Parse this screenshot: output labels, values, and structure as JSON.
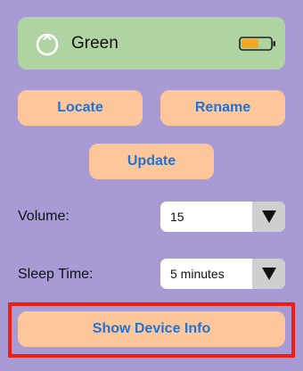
{
  "device": {
    "name": "Green",
    "icon": "power-ring-icon",
    "battery_icon": "battery-icon",
    "battery_level": 0.6,
    "battery_color": "#f5a623"
  },
  "actions": {
    "locate_label": "Locate",
    "rename_label": "Rename",
    "update_label": "Update",
    "show_info_label": "Show Device Info"
  },
  "settings": {
    "volume_label": "Volume:",
    "volume_value": "15",
    "sleep_label": "Sleep Time:",
    "sleep_value": "5 minutes"
  },
  "colors": {
    "background": "#a79ad5",
    "card": "#afd4a2",
    "button": "#fdc69b",
    "button_text": "#1f73d6",
    "highlight": "#f21d10"
  }
}
